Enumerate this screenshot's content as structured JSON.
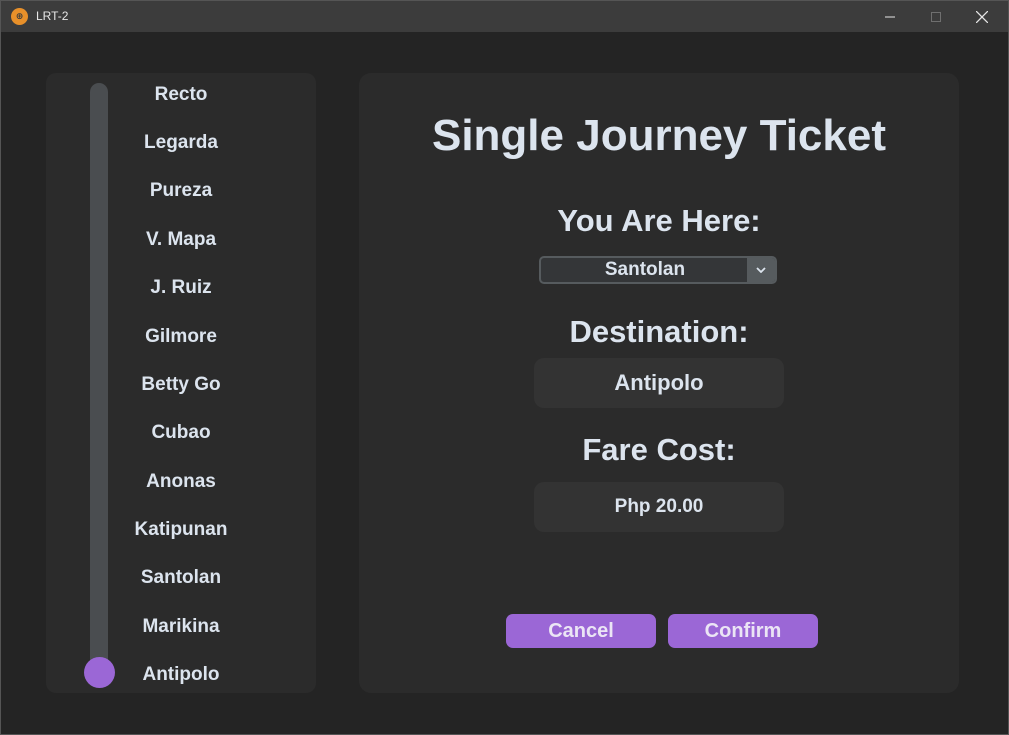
{
  "window": {
    "title": "LRT-2",
    "app_icon": "lrt-logo-icon",
    "controls": [
      "minimize-icon",
      "maximize-icon",
      "close-icon"
    ]
  },
  "stations": {
    "items": [
      {
        "label": "Recto"
      },
      {
        "label": "Legarda"
      },
      {
        "label": "Pureza"
      },
      {
        "label": "V. Mapa"
      },
      {
        "label": "J. Ruiz"
      },
      {
        "label": "Gilmore"
      },
      {
        "label": "Betty Go"
      },
      {
        "label": "Cubao"
      },
      {
        "label": "Anonas"
      },
      {
        "label": "Katipunan"
      },
      {
        "label": "Santolan"
      },
      {
        "label": "Marikina"
      },
      {
        "label": "Antipolo"
      }
    ],
    "slider_selected_index": 12,
    "slider_position_fraction": 1.0
  },
  "ticket": {
    "title": "Single Journey Ticket",
    "origin_label": "You Are Here:",
    "origin_value": "Santolan",
    "destination_label": "Destination:",
    "destination_value": "Antipolo",
    "fare_label": "Fare Cost:",
    "fare_value": "Php 20.00"
  },
  "actions": {
    "cancel_label": "Cancel",
    "confirm_label": "Confirm"
  },
  "colors": {
    "accent": "#9b67d6",
    "panel": "#2b2b2b",
    "background": "#242424",
    "text": "#dce4ee"
  }
}
